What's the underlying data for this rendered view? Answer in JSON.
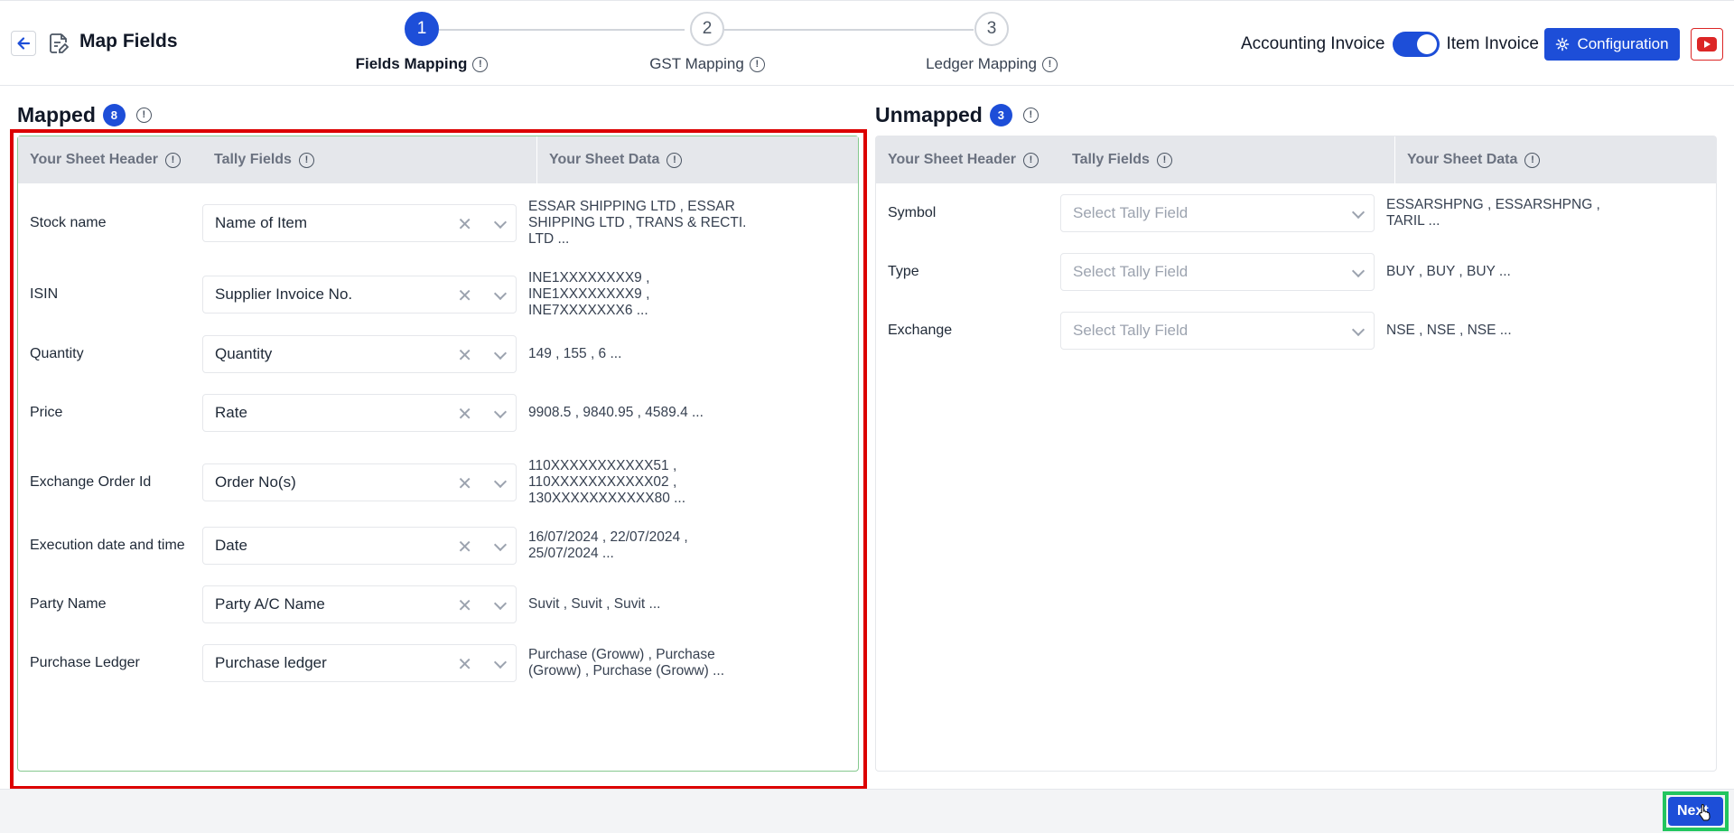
{
  "header": {
    "title": "Map Fields",
    "steps": [
      {
        "number": "1",
        "label": "Fields Mapping"
      },
      {
        "number": "2",
        "label": "GST Mapping"
      },
      {
        "number": "3",
        "label": "Ledger Mapping"
      }
    ],
    "toggle_left": "Accounting Invoice",
    "toggle_right": "Item Invoice",
    "config_label": "Configuration"
  },
  "mapped": {
    "title": "Mapped",
    "count": "8",
    "columns": [
      "Your Sheet Header",
      "Tally Fields",
      "Your Sheet Data"
    ],
    "rows": [
      {
        "header": "Stock name",
        "field": "Name of Item",
        "data": "ESSAR SHIPPING LTD , ESSAR SHIPPING LTD , TRANS & RECTI. LTD ..."
      },
      {
        "header": "ISIN",
        "field": "Supplier Invoice No.",
        "data": "INE1XXXXXXXX9 , INE1XXXXXXXX9 , INE7XXXXXXX6 ..."
      },
      {
        "header": "Quantity",
        "field": "Quantity",
        "data": "149 , 155 , 6 ..."
      },
      {
        "header": "Price",
        "field": "Rate",
        "data": "9908.5 , 9840.95 , 4589.4 ..."
      },
      {
        "header": "Exchange Order Id",
        "field": "Order No(s)",
        "data": "110XXXXXXXXXXX51 , 110XXXXXXXXXXX02 , 130XXXXXXXXXXX80 ..."
      },
      {
        "header": "Execution date and time",
        "field": "Date",
        "data": "16/07/2024 , 22/07/2024 , 25/07/2024 ..."
      },
      {
        "header": "Party Name",
        "field": "Party A/C Name",
        "data": "Suvit , Suvit , Suvit ..."
      },
      {
        "header": "Purchase Ledger",
        "field": "Purchase ledger",
        "data": "Purchase (Groww) , Purchase (Groww) , Purchase (Groww) ..."
      }
    ]
  },
  "unmapped": {
    "title": "Unmapped",
    "count": "3",
    "columns": [
      "Your Sheet Header",
      "Tally Fields",
      "Your Sheet Data"
    ],
    "placeholder": "Select Tally Field",
    "rows": [
      {
        "header": "Symbol",
        "data": "ESSARSHPNG , ESSARSHPNG , TARIL ..."
      },
      {
        "header": "Type",
        "data": "BUY , BUY , BUY ..."
      },
      {
        "header": "Exchange",
        "data": "NSE , NSE , NSE ..."
      }
    ]
  },
  "footer": {
    "next_label": "Next"
  },
  "colors": {
    "primary": "#1d4ed8",
    "mapped_border": "#86c98f",
    "highlight_red": "#dc0000",
    "highlight_green": "#22c55e"
  }
}
